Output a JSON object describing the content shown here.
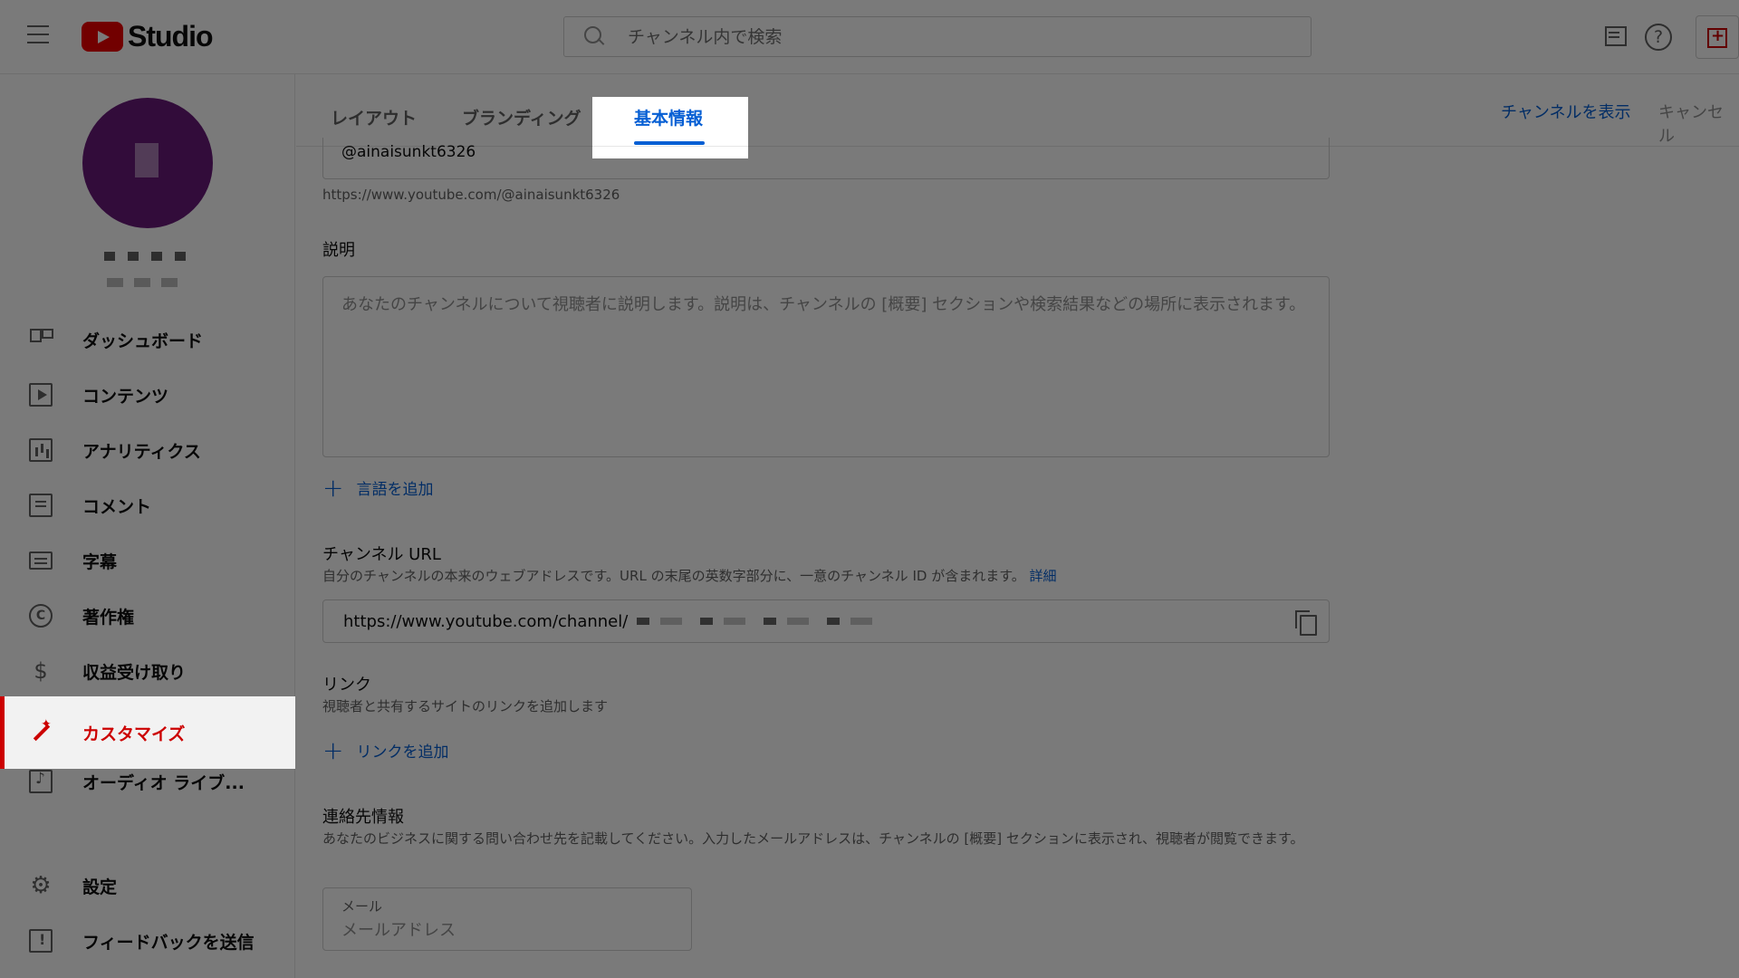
{
  "header": {
    "brand": "Studio",
    "search_placeholder": "チャンネル内で検索"
  },
  "sidebar": {
    "items": [
      {
        "label": "ダッシュボード"
      },
      {
        "label": "コンテンツ"
      },
      {
        "label": "アナリティクス"
      },
      {
        "label": "コメント"
      },
      {
        "label": "字幕"
      },
      {
        "label": "著作権"
      },
      {
        "label": "収益受け取り"
      },
      {
        "label": "カスタマイズ"
      },
      {
        "label": "オーディオ ライブ..."
      },
      {
        "label": "設定"
      },
      {
        "label": "フィードバックを送信"
      }
    ],
    "active_index": 7
  },
  "tabs": {
    "items": [
      {
        "label": "レイアウト"
      },
      {
        "label": "ブランディング"
      },
      {
        "label": "基本情報"
      }
    ],
    "active_index": 2,
    "view_channel": "チャンネルを表示",
    "cancel": "キャンセル"
  },
  "main": {
    "handle_value": "@ainaisunkt6326",
    "handle_url": "https://www.youtube.com/@ainaisunkt6326",
    "description": {
      "title": "説明",
      "placeholder": "あなたのチャンネルについて視聴者に説明します。説明は、チャンネルの [概要] セクションや検索結果などの場所に表示されます。",
      "add_language": "言語を追加"
    },
    "channel_url": {
      "title": "チャンネル URL",
      "desc": "自分のチャンネルの本来のウェブアドレスです。URL の末尾の英数字部分に、一意のチャンネル ID が含まれます。",
      "detail_link": "詳細",
      "value": "https://www.youtube.com/channel/"
    },
    "links": {
      "title": "リンク",
      "desc": "視聴者と共有するサイトのリンクを追加します",
      "add_link": "リンクを追加"
    },
    "contact": {
      "title": "連絡先情報",
      "desc": "あなたのビジネスに関する問い合わせ先を記載してください。入力したメールアドレスは、チャンネルの [概要] セクションに表示され、視聴者が閲覧できます。",
      "email_label": "メール",
      "email_placeholder": "メールアドレス"
    }
  },
  "colors": {
    "accent_red": "#cc0000",
    "link_blue": "#065fd4"
  }
}
